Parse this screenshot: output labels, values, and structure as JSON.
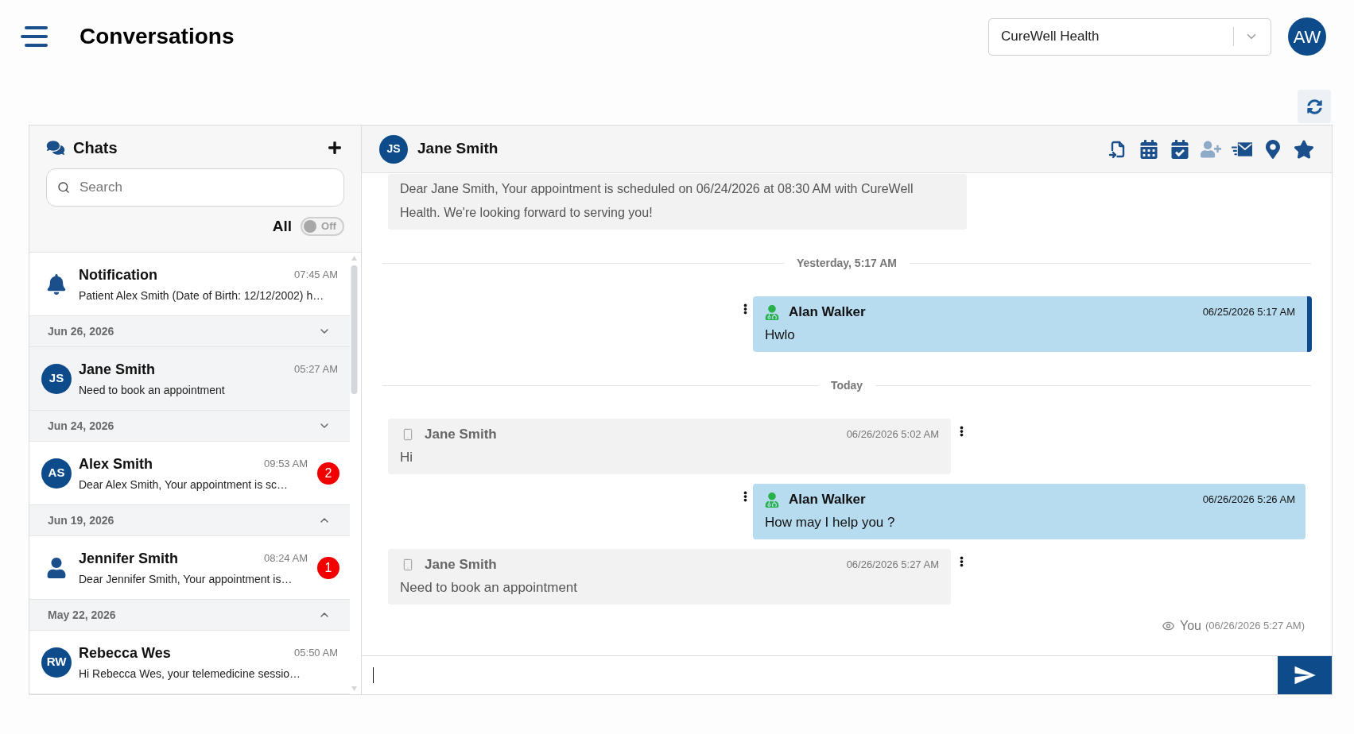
{
  "header": {
    "title": "Conversations",
    "organization": "CureWell Health",
    "user_initials": "AW"
  },
  "sidebar": {
    "title": "Chats",
    "search": {
      "placeholder": "Search"
    },
    "filter": {
      "label": "All",
      "on": false,
      "state_text": "Off"
    },
    "items": [
      {
        "kind": "notification",
        "name": "Notification",
        "time": "07:45 AM",
        "preview": "Patient Alex Smith (Date of Birth: 12/12/2002) h…",
        "selected": false
      },
      {
        "kind": "date",
        "label": "Jun 26, 2026",
        "expanded": false
      },
      {
        "kind": "chat",
        "initials": "JS",
        "name": "Jane Smith",
        "time": "05:27 AM",
        "preview": "Need to book an appointment",
        "selected": true
      },
      {
        "kind": "date",
        "label": "Jun 24, 2026",
        "expanded": false
      },
      {
        "kind": "chat",
        "initials": "AS",
        "name": "Alex Smith",
        "time": "09:53 AM",
        "preview": "Dear Alex Smith, Your appointment is sc…",
        "badge": "2",
        "selected": false
      },
      {
        "kind": "date",
        "label": "Jun 19, 2026",
        "expanded": true
      },
      {
        "kind": "chat",
        "name": "Jennifer Smith",
        "time": "08:24 AM",
        "preview": "Dear Jennifer Smith, Your appointment is…",
        "badge": "1",
        "selected": false
      },
      {
        "kind": "date",
        "label": "May 22, 2026",
        "expanded": true
      },
      {
        "kind": "chat",
        "initials": "RW",
        "name": "Rebecca Wes",
        "time": "05:50 AM",
        "preview": "Hi Rebecca Wes, your telemedicine sessio…",
        "selected": false
      }
    ]
  },
  "chat": {
    "contact": {
      "initials": "JS",
      "name": "Jane Smith"
    },
    "actions": [
      {
        "kind": "file-import",
        "disabled": false
      },
      {
        "kind": "calendar",
        "disabled": false
      },
      {
        "kind": "calendar-check",
        "disabled": false
      },
      {
        "kind": "user-plus",
        "disabled": true
      },
      {
        "kind": "mail",
        "disabled": false
      },
      {
        "kind": "location",
        "disabled": false
      },
      {
        "kind": "star",
        "disabled": false
      }
    ],
    "messages": [
      {
        "kind": "system",
        "text": "Dear Jane Smith, Your appointment is scheduled on 06/24/2026 at 08:30 AM with CureWell Health. We're looking forward to serving you!"
      },
      {
        "kind": "divider",
        "label": "Yesterday, 5:17 AM"
      },
      {
        "kind": "outgoing",
        "sender": "Alan Walker",
        "time": "06/25/2026 5:17 AM",
        "text": "Hwlo",
        "highlighted": true
      },
      {
        "kind": "divider",
        "label": "Today"
      },
      {
        "kind": "incoming",
        "sender": "Jane Smith",
        "time": "06/26/2026 5:02 AM",
        "text": "Hi"
      },
      {
        "kind": "outgoing",
        "sender": "Alan Walker",
        "time": "06/26/2026 5:26 AM",
        "text": "How may I help you ?",
        "highlighted": false
      },
      {
        "kind": "incoming",
        "sender": "Jane Smith",
        "time": "06/26/2026 5:27 AM",
        "text": "Need to book an appointment"
      }
    ],
    "seen": {
      "label": "You",
      "time": "(06/26/2026 5:27 AM)"
    }
  }
}
